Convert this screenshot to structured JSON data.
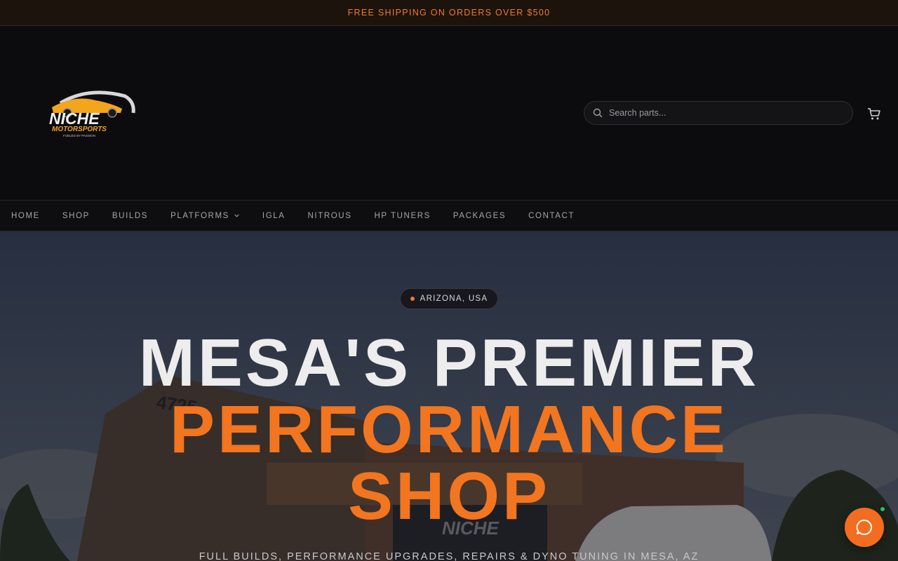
{
  "announcement": {
    "text": "FREE SHIPPING ON ORDERS OVER $500"
  },
  "brand": {
    "name": "NICHE",
    "sub": "MOTORSPORTS",
    "tagline": "FUELED BY PASSION"
  },
  "search": {
    "placeholder": "Search parts..."
  },
  "icons": {
    "search": "search-icon",
    "cart": "cart-icon",
    "chevron": "chevron-down-icon",
    "chat": "chat-bubble-icon"
  },
  "nav": {
    "items": [
      {
        "label": "HOME"
      },
      {
        "label": "SHOP"
      },
      {
        "label": "BUILDS"
      },
      {
        "label": "PLATFORMS"
      },
      {
        "label": "IGLA"
      },
      {
        "label": "NITROUS"
      },
      {
        "label": "HP TUNERS"
      },
      {
        "label": "PACKAGES"
      },
      {
        "label": "CONTACT"
      }
    ]
  },
  "hero": {
    "badge": "ARIZONA, USA",
    "line1": "MESA'S PREMIER",
    "line2": "PERFORMANCE",
    "line3": "SHOP",
    "subtitle": "FULL BUILDS, PERFORMANCE UPGRADES, REPAIRS & DYNO TUNING IN MESA, AZ",
    "building_number": "4725",
    "sign_text": "NICHE"
  },
  "colors": {
    "accent": "#f27520",
    "online": "#22c55e"
  }
}
